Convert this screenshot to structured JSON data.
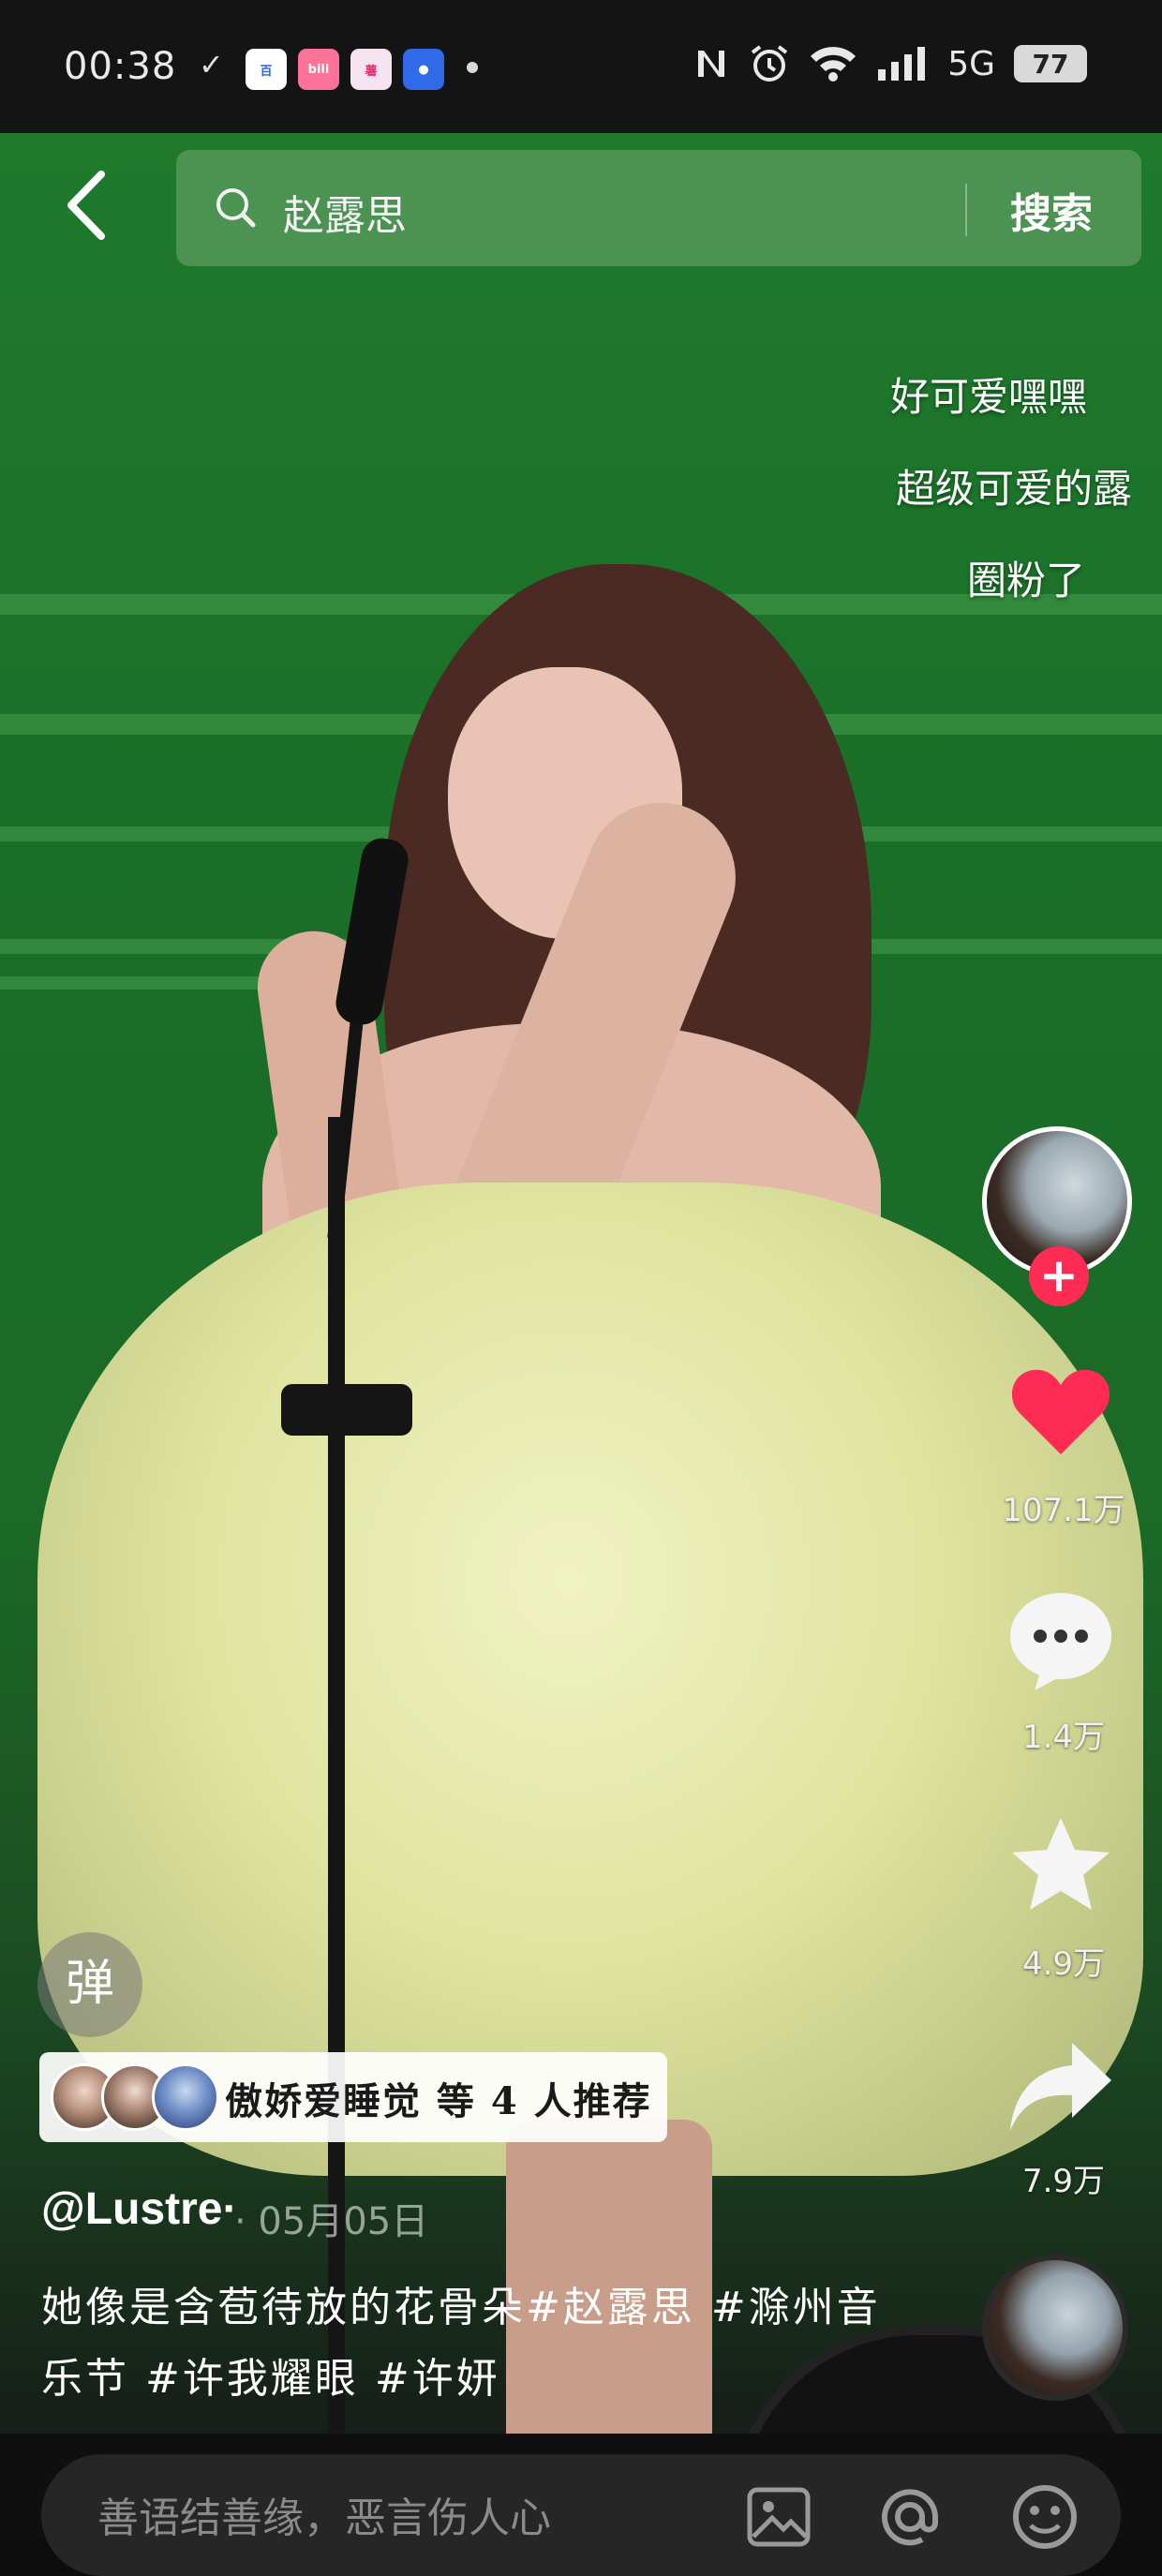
{
  "status_bar": {
    "time": "00:38",
    "check_mark": "✓",
    "apps": [
      {
        "name": "baidu-app-icon",
        "label": "百",
        "bg": "#ffffff",
        "fg": "#2d63e6"
      },
      {
        "name": "bilibili-app-icon",
        "label": "bili",
        "bg": "#fb7299",
        "fg": "#ffffff"
      },
      {
        "name": "xiaohongshu-app-icon",
        "label": "薯",
        "bg": "#f5e4f0",
        "fg": "#e0306f"
      },
      {
        "name": "blue-app-icon",
        "label": "●",
        "bg": "#2f6be8",
        "fg": "#ffffff"
      }
    ],
    "network": "5G",
    "battery": "77"
  },
  "header": {
    "search_query": "赵露思",
    "search_button": "搜索"
  },
  "floating_comments": [
    "好可爱嘿嘿",
    "超级可爱的露",
    "圈粉了"
  ],
  "actions": {
    "likes": "107.1万",
    "comments": "1.4万",
    "favorites": "4.9万",
    "shares": "7.9万"
  },
  "danmu_button": "弹",
  "recommendation": {
    "text": "傲娇爱睡觉 等 4 人推荐"
  },
  "post": {
    "username": "@Lustre·",
    "date": "· 05月05日",
    "caption": "她像是含苞待放的花骨朵#赵露思 #滁州音乐节 #许我耀眼 #许妍"
  },
  "comment_input": {
    "placeholder": "善语结善缘，恶言伤人心"
  },
  "colors": {
    "like": "#fe2c55",
    "follow": "#fe2c55",
    "stage_green": "#1f7a2c"
  }
}
